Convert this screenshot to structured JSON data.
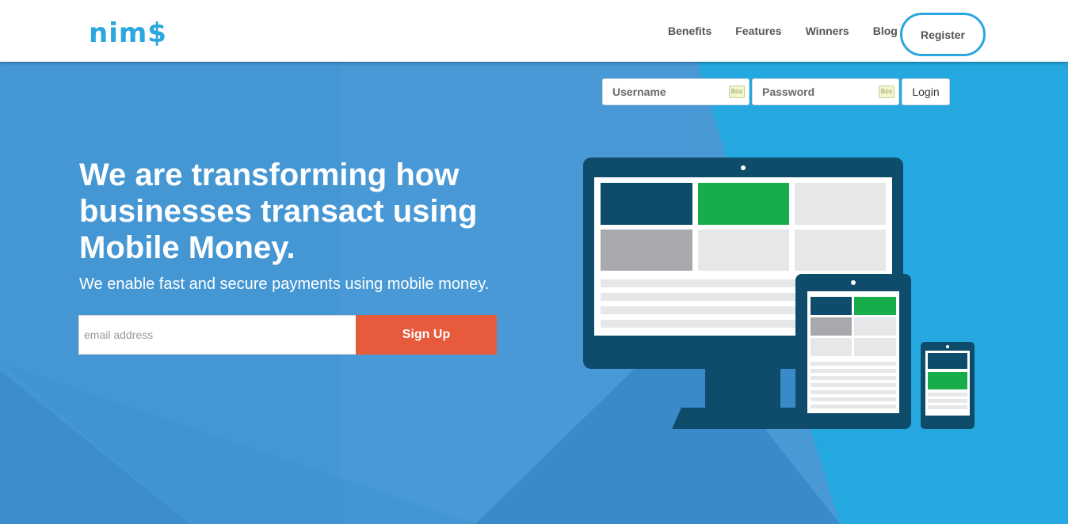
{
  "brand": {
    "logo_text": "nim$",
    "accent": "#2aa7de"
  },
  "nav": {
    "items": [
      "Benefits",
      "Features",
      "Winners",
      "Blog"
    ],
    "register_label": "Register"
  },
  "login": {
    "username_placeholder": "Username",
    "password_placeholder": "Password",
    "autofill_badge": "Box",
    "login_label": "Login"
  },
  "hero": {
    "headline": "We are transforming how businesses transact using Mobile Money.",
    "subline": "We enable fast and secure payments using mobile money.",
    "email_placeholder": "email address",
    "signup_label": "Sign Up"
  },
  "colors": {
    "background": "#4597d4",
    "background_right": "#25a8e0",
    "signup_button": "#e85a3c",
    "device_dark": "#0f4c6b",
    "tile_green": "#16ad4a",
    "tile_gray": "#a8a9ad",
    "tile_light": "#e6e7e8"
  },
  "icons": {
    "autofill": "box-autofill-icon",
    "illustration": "devices-illustration"
  }
}
